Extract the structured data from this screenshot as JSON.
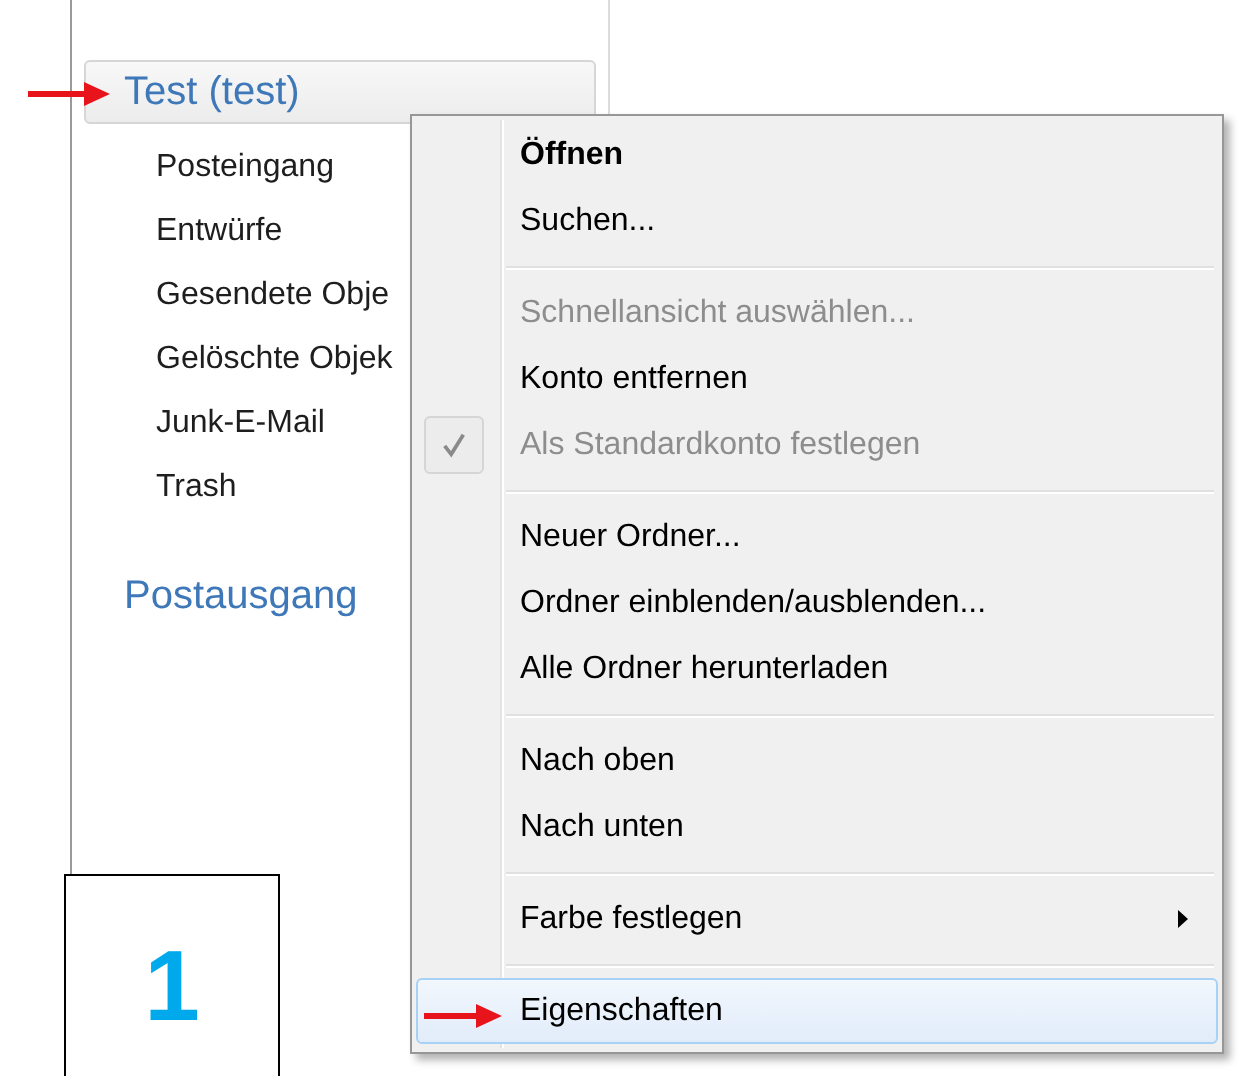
{
  "sidebar": {
    "account": "Test (test)",
    "folders": [
      {
        "label": "Posteingang"
      },
      {
        "label": "Entwürfe"
      },
      {
        "label": "Gesendete Obje"
      },
      {
        "label": "Gelöschte Objek"
      },
      {
        "label": "Junk-E-Mail"
      },
      {
        "label": "Trash"
      }
    ],
    "outbox": "Postausgang"
  },
  "context_menu": {
    "groups": [
      {
        "items": [
          {
            "label": "Öffnen",
            "default": true,
            "disabled": false,
            "checked": false,
            "submenu": false,
            "selected": false
          },
          {
            "label": "Suchen...",
            "default": false,
            "disabled": false,
            "checked": false,
            "submenu": false,
            "selected": false
          }
        ]
      },
      {
        "items": [
          {
            "label": "Schnellansicht auswählen...",
            "default": false,
            "disabled": true,
            "checked": false,
            "submenu": false,
            "selected": false
          },
          {
            "label": "Konto entfernen",
            "default": false,
            "disabled": false,
            "checked": false,
            "submenu": false,
            "selected": false
          },
          {
            "label": "Als Standardkonto festlegen",
            "default": false,
            "disabled": true,
            "checked": true,
            "submenu": false,
            "selected": false
          }
        ]
      },
      {
        "items": [
          {
            "label": "Neuer Ordner...",
            "default": false,
            "disabled": false,
            "checked": false,
            "submenu": false,
            "selected": false
          },
          {
            "label": "Ordner einblenden/ausblenden...",
            "default": false,
            "disabled": false,
            "checked": false,
            "submenu": false,
            "selected": false
          },
          {
            "label": "Alle Ordner herunterladen",
            "default": false,
            "disabled": false,
            "checked": false,
            "submenu": false,
            "selected": false
          }
        ]
      },
      {
        "items": [
          {
            "label": "Nach oben",
            "default": false,
            "disabled": false,
            "checked": false,
            "submenu": false,
            "selected": false
          },
          {
            "label": "Nach unten",
            "default": false,
            "disabled": false,
            "checked": false,
            "submenu": false,
            "selected": false
          }
        ]
      },
      {
        "items": [
          {
            "label": "Farbe festlegen",
            "default": false,
            "disabled": false,
            "checked": false,
            "submenu": true,
            "selected": false
          }
        ]
      },
      {
        "items": [
          {
            "label": "Eigenschaften",
            "default": false,
            "disabled": false,
            "checked": false,
            "submenu": false,
            "selected": true
          }
        ]
      }
    ]
  },
  "step_label": "1"
}
